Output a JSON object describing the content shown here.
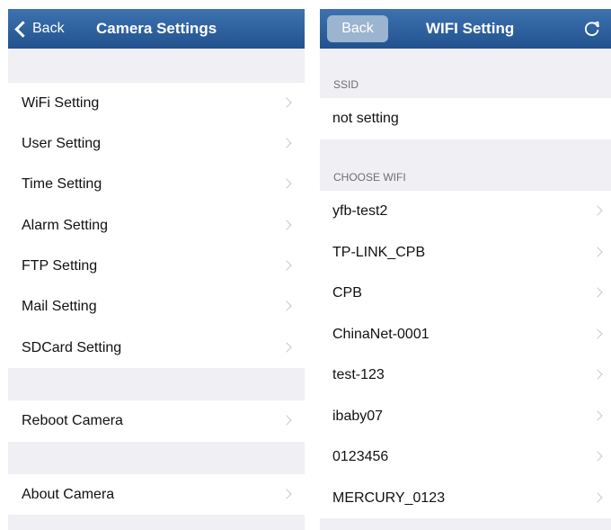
{
  "left": {
    "back_label": "Back",
    "title": "Camera Settings",
    "group1": [
      "WiFi Setting",
      "User Setting",
      "Time Setting",
      "Alarm Setting",
      "FTP Setting",
      "Mail Setting",
      "SDCard Setting"
    ],
    "reboot": "Reboot Camera",
    "about": "About Camera"
  },
  "right": {
    "back_label": "Back",
    "title": "WIFI Setting",
    "ssid_header": "SSID",
    "ssid_value": "not setting",
    "choose_header": "CHOOSE WIFI",
    "networks": [
      "yfb-test2",
      "TP-LINK_CPB",
      "CPB",
      "ChinaNet-0001",
      "test-123",
      "ibaby07",
      "0123456",
      "MERCURY_0123"
    ]
  },
  "icons": {
    "back": "chevron-left-icon",
    "refresh": "refresh-icon",
    "disclosure": "chevron-right-icon"
  },
  "colors": {
    "navbar": "#2c5f9e",
    "background": "#efeff4",
    "back_pill": "#9bb4d0"
  }
}
